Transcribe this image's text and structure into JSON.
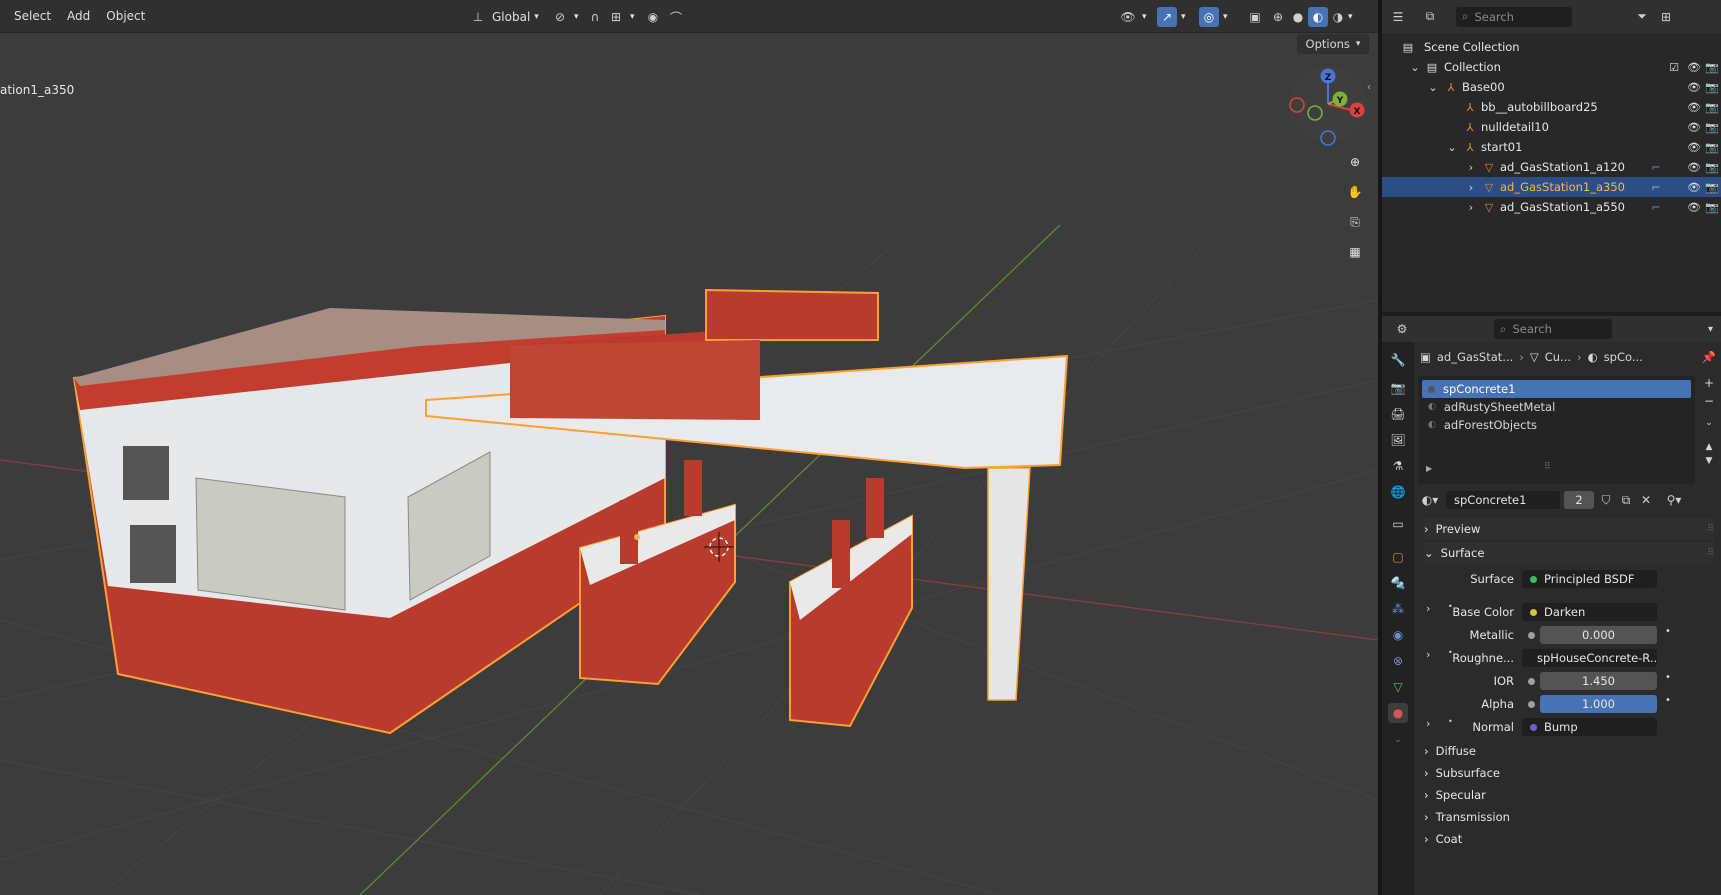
{
  "viewport": {
    "menus": [
      "Select",
      "Add",
      "Object"
    ],
    "transform_orientation": "Global",
    "options_label": "Options",
    "object_label": "ation1_a350",
    "gizmo": {
      "z": "Z",
      "y": "Y",
      "x": "X"
    }
  },
  "outliner": {
    "search_placeholder": "Search",
    "scene_collection": "Scene Collection",
    "rows": [
      {
        "label": "Collection"
      },
      {
        "label": "Base00"
      },
      {
        "label": "bb__autobillboard25"
      },
      {
        "label": "nulldetail10"
      },
      {
        "label": "start01"
      },
      {
        "label": "ad_GasStation1_a120"
      },
      {
        "label": "ad_GasStation1_a350"
      },
      {
        "label": "ad_GasStation1_a550"
      }
    ]
  },
  "properties": {
    "search_placeholder": "Search",
    "breadcrumb": [
      "ad_GasStat...",
      "Cu...",
      "spCo..."
    ],
    "material_slots": [
      "spConcrete1",
      "adRustySheetMetal",
      "adForestObjects"
    ],
    "material_name": "spConcrete1",
    "user_count": "2",
    "panels": {
      "preview": "Preview",
      "surface": "Surface"
    },
    "surface": {
      "surface_label": "Surface",
      "surface_value": "Principled BSDF",
      "base_color_label": "Base Color",
      "base_color_value": "Darken",
      "metallic_label": "Metallic",
      "metallic_value": "0.000",
      "roughness_label": "Roughne...",
      "roughness_value": "spHouseConcrete-R....",
      "ior_label": "IOR",
      "ior_value": "1.450",
      "alpha_label": "Alpha",
      "alpha_value": "1.000",
      "normal_label": "Normal",
      "normal_value": "Bump"
    },
    "subpanels": [
      "Diffuse",
      "Subsurface",
      "Specular",
      "Transmission",
      "Coat"
    ]
  },
  "colors": {
    "accent": "#4772b3",
    "selection": "#2c4e86",
    "outline": "#ff9f2e",
    "object": "#c24a3a"
  }
}
